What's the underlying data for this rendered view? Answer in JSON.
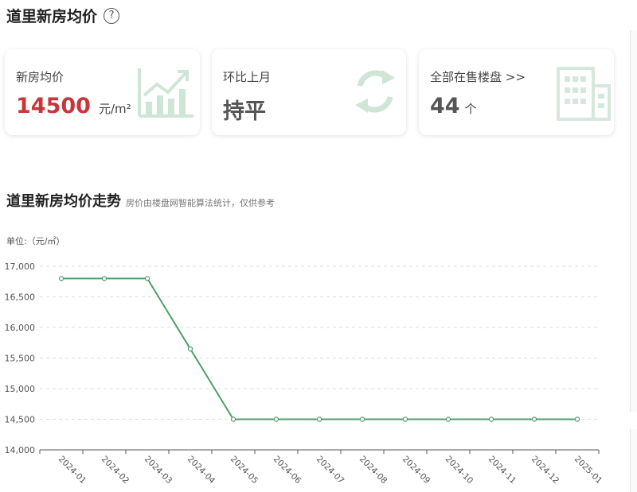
{
  "header": {
    "title": "道里新房均价",
    "help_icon": "question-circle-icon"
  },
  "cards": [
    {
      "label": "新房均价",
      "value": "14500",
      "unit": "元/m²",
      "value_color": "#c8353a",
      "icon": "trend-up-chart-icon"
    },
    {
      "label": "环比上月",
      "value": "持平",
      "unit": "",
      "value_color": "#555555",
      "icon": "refresh-arrows-icon"
    },
    {
      "label": "全部在售楼盘 >>",
      "value": "44",
      "unit": "个",
      "value_color": "#555555",
      "icon": "building-icon"
    }
  ],
  "section": {
    "title": "道里新房均价走势",
    "note": "房价由楼盘网智能算法统计，仅供参考"
  },
  "chart_unit_label": "单位:（元/㎡）",
  "colors": {
    "line": "#4f9e6a",
    "icon": "#cfe5d6",
    "grid": "#dddddd",
    "axis": "#555555"
  },
  "chart_data": {
    "type": "line",
    "title": "",
    "xlabel": "",
    "ylabel": "单位:（元/㎡）",
    "categories": [
      "2024-01",
      "2024-02",
      "2024-03",
      "2024-04",
      "2024-05",
      "2024-06",
      "2024-07",
      "2024-08",
      "2024-09",
      "2024-10",
      "2024-11",
      "2024-12",
      "2025-01"
    ],
    "y_ticks": [
      14000,
      14500,
      15000,
      15500,
      16000,
      16500,
      17000
    ],
    "y_tick_labels": [
      "14,000",
      "14,500",
      "15,000",
      "15,500",
      "16,000",
      "16,500",
      "17,000"
    ],
    "ylim": [
      14000,
      17000
    ],
    "grid": "horizontal-dashed",
    "values": [
      16800,
      16800,
      16800,
      15650,
      14500,
      14500,
      14500,
      14500,
      14500,
      14500,
      14500,
      14500,
      14500
    ]
  }
}
